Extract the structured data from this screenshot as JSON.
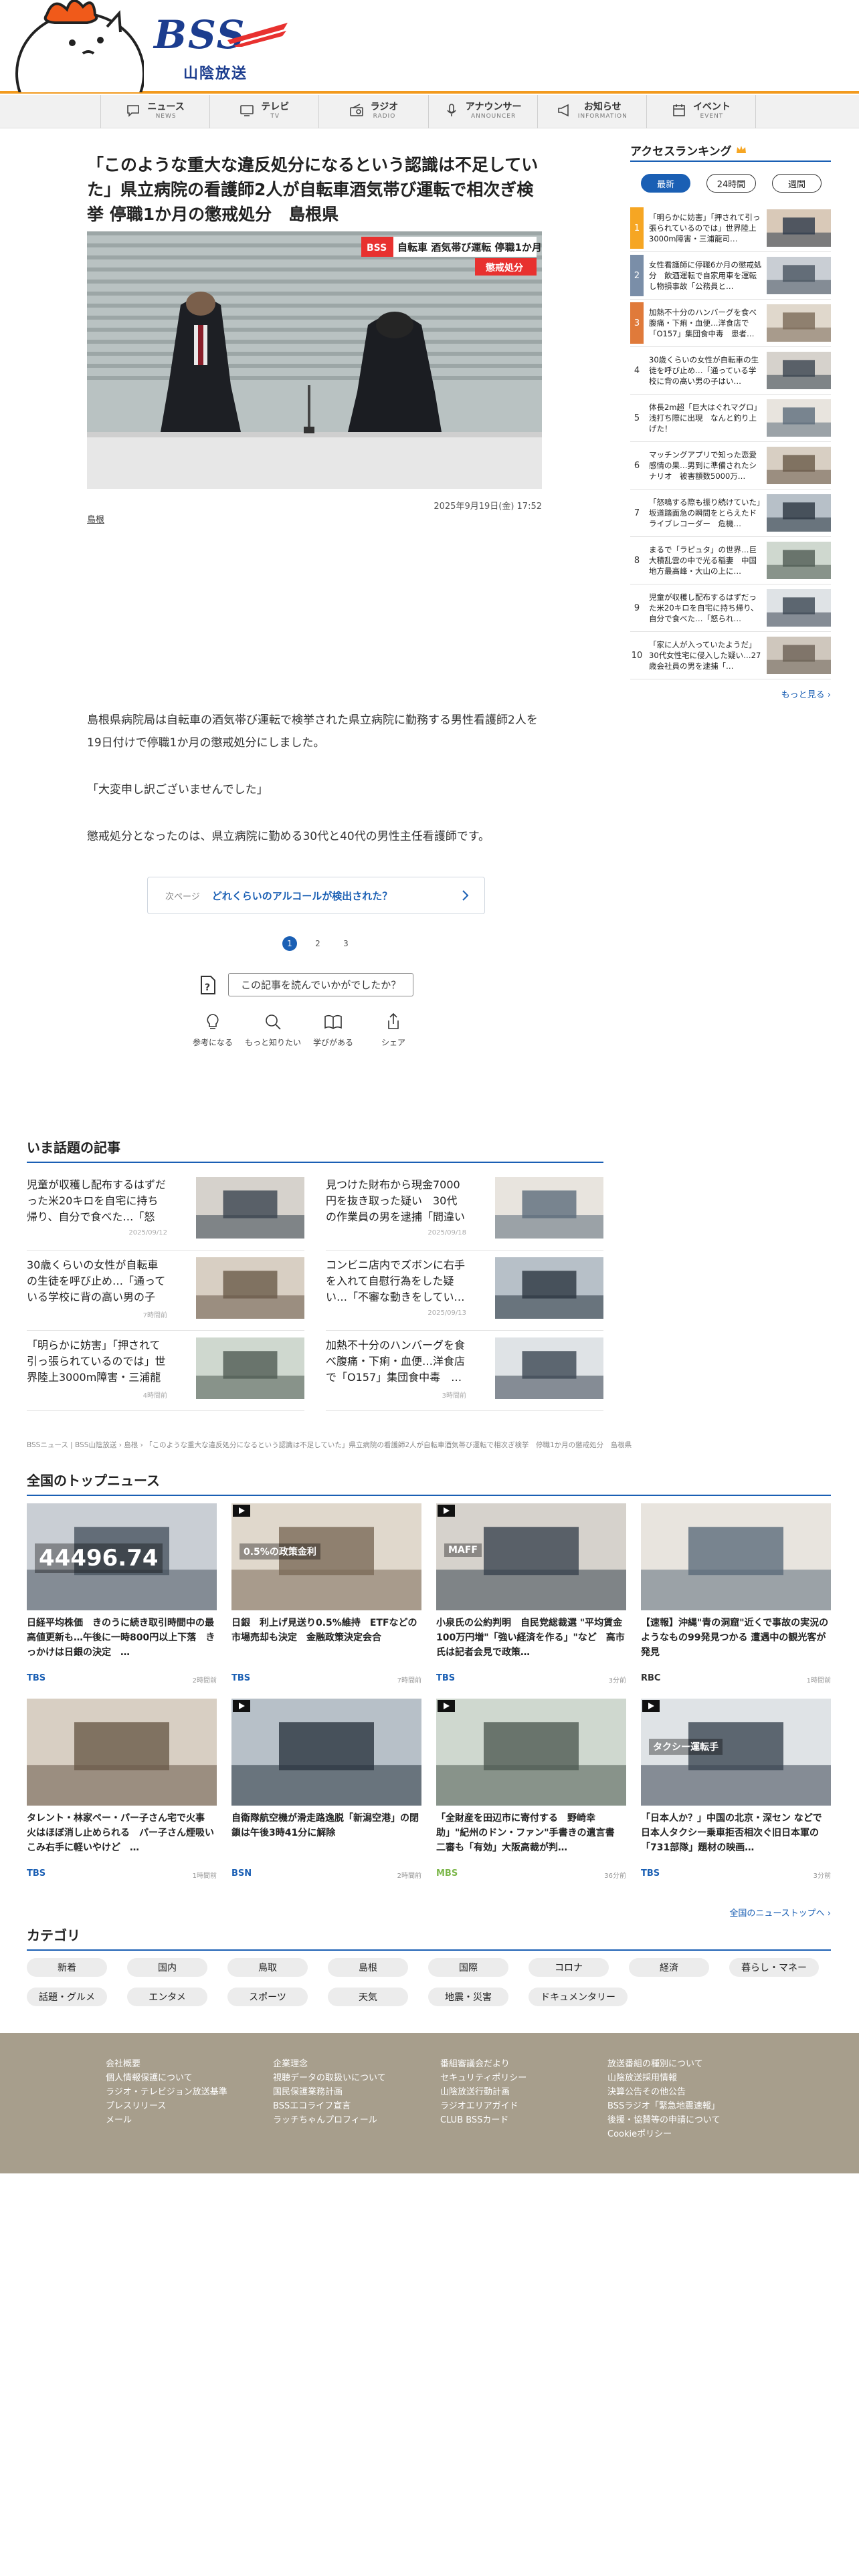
{
  "header": {
    "logo_text": "BSS",
    "logo_sub": "山陰放送"
  },
  "nav": [
    {
      "ja": "ニュース",
      "en": "NEWS",
      "icon": "chat-icon"
    },
    {
      "ja": "テレビ",
      "en": "TV",
      "icon": "tv-icon"
    },
    {
      "ja": "ラジオ",
      "en": "RADIO",
      "icon": "radio-icon"
    },
    {
      "ja": "アナウンサー",
      "en": "ANNOUNCER",
      "icon": "microphone-icon"
    },
    {
      "ja": "お知らせ",
      "en": "INFORMATION",
      "icon": "megaphone-icon"
    },
    {
      "ja": "イベント",
      "en": "EVENT",
      "icon": "calendar-icon"
    }
  ],
  "article": {
    "title": "「このような重大な違反処分になるという認識は不足していた」県立病院の看護師2人が自転車酒気帯び運転で相次ぎ検挙 停職1か月の懲戒処分　島根県",
    "photo_caption_top": "自転車 酒気帯び運転 停職1か月",
    "photo_caption_sub": "懲戒処分",
    "photo_badge": "BSS",
    "date": "2025年9月19日(金) 17:52",
    "tag": "島根",
    "paragraphs": [
      "島根県病院局は自転車の酒気帯び運転で検挙された県立病院に勤務する男性看護師2人を19日付けで停職1か月の懲戒処分にしました。",
      "「大変申し訳ございませんでした」",
      "懲戒処分となったのは、県立病院に勤める30代と40代の男性主任看護師です。"
    ],
    "next_label": "次ページ",
    "next_title": "どれくらいのアルコールが検出された？",
    "pages": [
      "1",
      "2",
      "3"
    ],
    "feedback_q": "この記事を読んでいかがでしたか？",
    "feedback_btns": [
      {
        "label": "参考になる",
        "icon": "lightbulb-icon"
      },
      {
        "label": "もっと知りたい",
        "icon": "magnifier-icon"
      },
      {
        "label": "学びがある",
        "icon": "book-icon"
      },
      {
        "label": "シェア",
        "icon": "share-icon"
      }
    ]
  },
  "ranking": {
    "title": "アクセスランキング",
    "tabs": [
      "最新",
      "24時間",
      "週間"
    ],
    "items": [
      {
        "n": "1",
        "text": "「明らかに妨害」「押されて引っ張られているのでは」世界陸上3000m障害・三浦龍司…"
      },
      {
        "n": "2",
        "text": "女性看護師に停職6か月の懲戒処分　飲酒運転で自家用車を運転し物損事故「公務員と…"
      },
      {
        "n": "3",
        "text": "加熱不十分のハンバーグを食べ腹痛・下痢・血便…洋食店で「O157」集団食中毒　患者…"
      },
      {
        "n": "4",
        "text": "30歳くらいの女性が自転車の生徒を呼び止め…「通っている学校に背の高い男の子はい…"
      },
      {
        "n": "5",
        "text": "体長2m超「巨大はぐれマグロ」浅打ち際に出現　なんと釣り上げた！"
      },
      {
        "n": "6",
        "text": "マッチングアプリで知った恋愛感情の果…男到に準備されたシナリオ　被害額数5000万…"
      },
      {
        "n": "7",
        "text": "「怒鳴する際も振り続けていた」坂道踏面急の瞬間をとらえたドライブレコーダー　危機…"
      },
      {
        "n": "8",
        "text": "まるで「ラピュタ」の世界…巨大積乱雲の中で光る稲妻　中国地方最高峰・大山の上に…"
      },
      {
        "n": "9",
        "text": "児童が収穫し配布するはずだった米20キロを自宅に持ち帰り、自分で食べた…「怒られ…"
      },
      {
        "n": "10",
        "text": "「家に人が入っていたようだ」30代女性宅に侵入した疑い…27歳会社員の男を逮捕「…"
      }
    ],
    "more": "もっと見る ›"
  },
  "hot": {
    "title": "いま話題の記事",
    "items": [
      {
        "title": "児童が収穫し配布するはずだった米20キロを自宅に持ち帰り、自分で食べた…「怒ら…",
        "date": "2025/09/12"
      },
      {
        "title": "見つけた財布から現金7000円を抜き取った疑い　30代の作業員の男を逮捕「間違いあ…",
        "date": "2025/09/18"
      },
      {
        "title": "30歳くらいの女性が自転車の生徒を呼び止め…「通っている学校に背の高い男の子は…",
        "date": "7時間前"
      },
      {
        "title": "コンビニ店内でズボンに右手を入れて自慰行為をした疑い…「不審な動きをしてい…",
        "date": "2025/09/13"
      },
      {
        "title": "「明らかに妨害」「押されて引っ張られているのでは」世界陸上3000m障害・三浦龍司…",
        "date": "4時間前"
      },
      {
        "title": "加熱不十分のハンバーグを食べ腹痛・下痢・血便…洋食店で「O157」集団食中毒　…",
        "date": "3時間前"
      }
    ]
  },
  "breadcrumb": "BSSニュース | BSS山陰放送 › 島根 › 「このような重大な違反処分になるという認識は不足していた」県立病院の看護師2人が自転車酒気帯び運転で相次ぎ検挙　停職1か月の懲戒処分　島根県",
  "topnews": {
    "title": "全国のトップニュース",
    "items": [
      {
        "title": "日経平均株価　きのうに続き取引時間中の最高値更新も…午後に一時800円以上下落　きっかけは日銀の決定　…",
        "src": "TBS",
        "date": "2時間前",
        "src_color": "#1a5fb4",
        "video": false,
        "thumb_text": "44496.74"
      },
      {
        "title": "日銀　利上げ見送り0.5%維持　ETFなどの市場売却も決定　金融政策決定会合",
        "src": "TBS",
        "date": "7時間前",
        "src_color": "#1a5fb4",
        "video": true,
        "thumb_text": "0.5%の政策金利"
      },
      {
        "title": "小泉氏の公約判明　自民党総裁選 \"平均賃金100万円増\"「強い経済を作る」\"など　高市氏は記者会見で政策…",
        "src": "TBS",
        "date": "3分前",
        "src_color": "#1a5fb4",
        "video": true,
        "thumb_text": "MAFF"
      },
      {
        "title": "【速報】沖縄\"青の洞窟\"近くで事故の実況のようなもの99発見つかる 遭遇中の観光客が発見",
        "src": "RBC",
        "date": "1時間前",
        "src_color": "#333",
        "video": false,
        "thumb_text": ""
      },
      {
        "title": "タレント・林家ペー・パー子さん宅で火事　火はほぼ消し止められる　パー子さん煙吸いこみ右手に軽いやけど　…",
        "src": "TBS",
        "date": "1時間前",
        "src_color": "#1a5fb4",
        "video": false,
        "thumb_text": ""
      },
      {
        "title": "自衛隊航空機が滑走路逸脱「新潟空港」の閉鎖は午後3時41分に解除",
        "src": "BSN",
        "date": "2時間前",
        "src_color": "#1a5fb4",
        "video": true,
        "thumb_text": ""
      },
      {
        "title": "「全財産を田辺市に寄付する　野崎幸助」\"紀州のドン・ファン\"手書きの遺言書 二審も「有効」大阪高裁が判…",
        "src": "MBS",
        "date": "36分前",
        "src_color": "#7ab648",
        "video": true,
        "thumb_text": ""
      },
      {
        "title": "「日本人か？」中国の北京・深セン などで日本人タクシー乗車拒否相次ぐ旧日本軍の「731部隊」題材の映画…",
        "src": "TBS",
        "date": "3分前",
        "src_color": "#1a5fb4",
        "video": true,
        "thumb_text": "タクシー運転手"
      }
    ],
    "more": "全国のニューストップへ ›"
  },
  "category": {
    "title": "カテゴリ",
    "items": [
      "新着",
      "国内",
      "鳥取",
      "島根",
      "国際",
      "コロナ",
      "経済",
      "暮らし・マネー",
      "話題・グルメ",
      "エンタメ",
      "スポーツ",
      "天気",
      "地震・災害",
      "ドキュメンタリー"
    ]
  },
  "footer": {
    "cols": [
      [
        "会社概要",
        "個人情報保護について",
        "ラジオ・テレビジョン放送基準",
        "プレスリリース",
        "メール"
      ],
      [
        "企業理念",
        "視聴データの取扱いについて",
        "国民保護業務計画",
        "BSSエコライフ宣言",
        "ラッチちゃんプロフィール"
      ],
      [
        "番組審議会だより",
        "セキュリティポリシー",
        "山陰放送行動計画",
        "ラジオエリアガイド",
        "CLUB BSSカード"
      ],
      [
        "放送番組の種別について",
        "山陰放送採用情報",
        "決算公告その他公告",
        "BSSラジオ「緊急地震速報」",
        "後援・協賛等の申請について",
        "Cookieポリシー"
      ]
    ]
  },
  "colors": {
    "accent": "#1a5fb4",
    "brand_orange": "#f29a1e",
    "footer_bg": "#a79e8c"
  }
}
